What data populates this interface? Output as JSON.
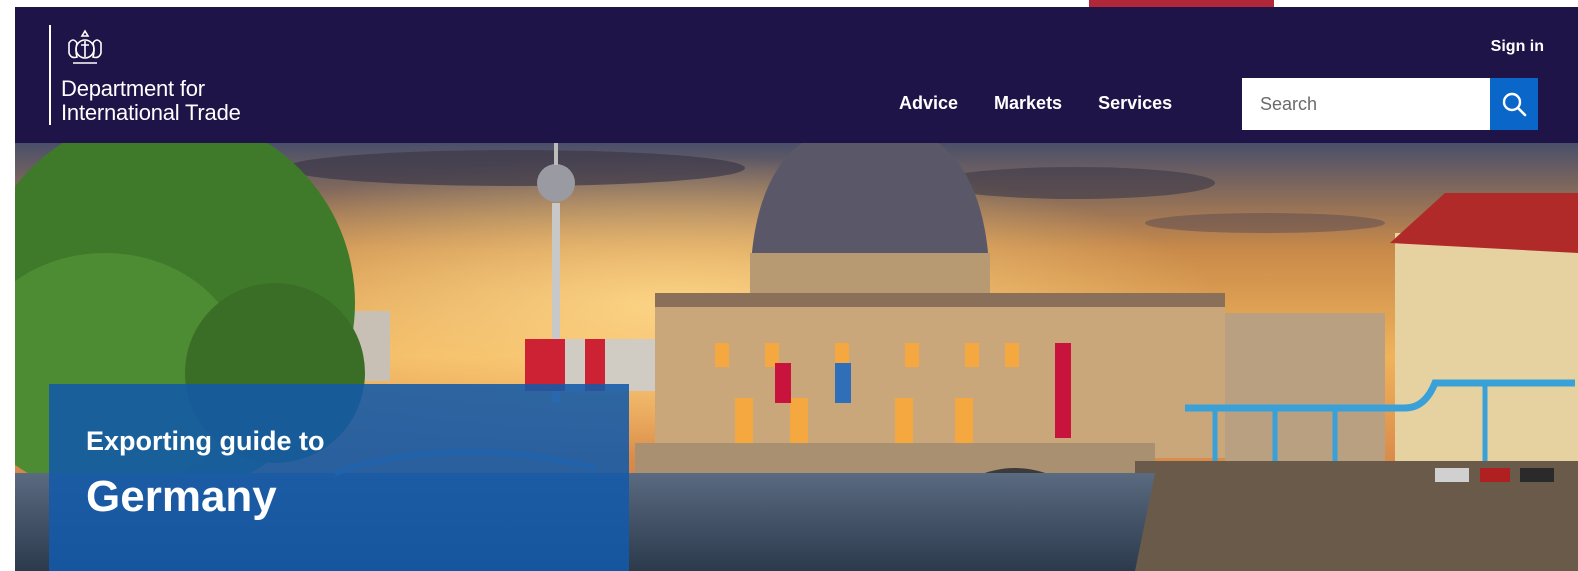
{
  "header": {
    "org_name_line1": "Department for",
    "org_name_line2": "International Trade",
    "sign_in_label": "Sign in",
    "nav": [
      {
        "label": "Advice"
      },
      {
        "label": "Markets"
      },
      {
        "label": "Services"
      }
    ],
    "search": {
      "placeholder": "Search",
      "value": "",
      "button_icon": "search-icon"
    },
    "logo_icon": "royal-crest-icon"
  },
  "hero": {
    "subtitle": "Exporting guide to",
    "title": "Germany",
    "image_subject": "Berlin Bode Museum at sunset with TV tower"
  },
  "colors": {
    "header_bg": "#1e1447",
    "accent_top": "#b0273a",
    "search_button": "#0a66c8",
    "hero_card": "#125aaa"
  }
}
